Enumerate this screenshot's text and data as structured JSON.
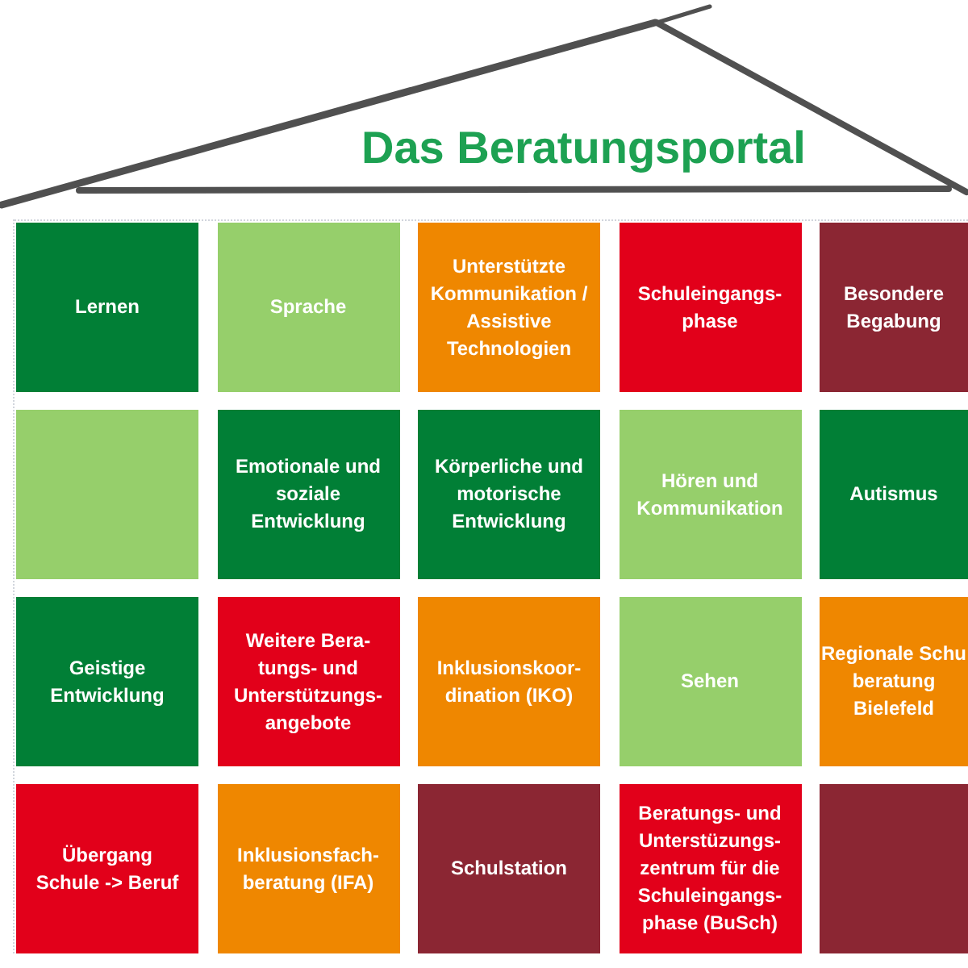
{
  "title": "Das Beratungsportal",
  "tiles": [
    [
      {
        "lines": [
          "Lernen"
        ],
        "color": "#017f36"
      },
      {
        "lines": [
          "Sprache"
        ],
        "color": "#96cf6b"
      },
      {
        "lines": [
          "Unterstützte",
          "Kommunikation /",
          "Assistive",
          "Technologien"
        ],
        "color": "#ef8700"
      },
      {
        "lines": [
          "Schuleingangs-",
          "phase"
        ],
        "color": "#e2001a"
      },
      {
        "lines": [
          "Besondere",
          "Begabung"
        ],
        "color": "#8b2633"
      }
    ],
    [
      {
        "color": "#96cf6b"
      },
      {
        "lines": [
          "Emotionale und",
          "soziale",
          "Entwicklung"
        ],
        "color": "#017f36"
      },
      {
        "lines": [
          "Körperliche und",
          "motorische",
          "Entwicklung"
        ],
        "color": "#017f36"
      },
      {
        "lines": [
          "Hören und",
          "Kommunikation"
        ],
        "color": "#96cf6b"
      },
      {
        "lines": [
          "Autismus"
        ],
        "color": "#017f36"
      }
    ],
    [
      {
        "lines": [
          "Geistige",
          "Entwicklung"
        ],
        "color": "#017f36"
      },
      {
        "lines": [
          "Weitere Bera-",
          "tungs- und",
          "Unterstützungs-",
          "angebote"
        ],
        "color": "#e2001a"
      },
      {
        "lines": [
          "Inklusionskoor-",
          "dination (IKO)"
        ],
        "color": "#ef8700"
      },
      {
        "lines": [
          "Sehen"
        ],
        "color": "#96cf6b"
      },
      {
        "lines": [
          "Regionale Schu",
          "beratung",
          "Bielefeld"
        ],
        "color": "#ef8700"
      }
    ],
    [
      {
        "lines": [
          "Übergang",
          "Schule -> Beruf"
        ],
        "color": "#e2001a"
      },
      {
        "lines": [
          "Inklusionsfach-",
          "beratung (IFA)"
        ],
        "color": "#ef8700"
      },
      {
        "lines": [
          "Schulstation"
        ],
        "color": "#8b2633"
      },
      {
        "lines": [
          "Beratungs- und",
          "Unterstüzungs-",
          "zentrum für die",
          "Schuleingangs-",
          "phase (BuSch)"
        ],
        "color": "#e2001a"
      },
      {
        "color": "#8b2633"
      }
    ]
  ]
}
